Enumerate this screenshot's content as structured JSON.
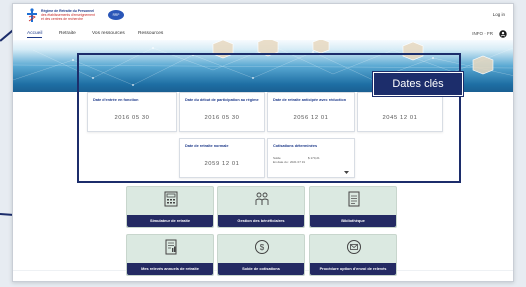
{
  "header": {
    "logo_line1": "Régime de Retraite du Personnel",
    "logo_line2": "des établissements d'enseignement",
    "logo_line3": "et des centres de recherche",
    "badge": "RRP",
    "login": "Log in"
  },
  "nav": {
    "items": [
      {
        "label": "Accueil",
        "active": true
      },
      {
        "label": "Retraite",
        "active": false
      },
      {
        "label": "Vos ressources",
        "active": false
      },
      {
        "label": "Ressources",
        "active": false
      }
    ],
    "right_text": "INFO · FR"
  },
  "callout": {
    "label": "Dates clés"
  },
  "cards": [
    {
      "title": "Date d'entrée en fonction",
      "value": "2016 05 30"
    },
    {
      "title": "Date du début de participation au régime",
      "value": "2016 05 30"
    },
    {
      "title": "Date de retraite anticipée avec réduction",
      "value": "2056 12 01"
    },
    {
      "title": "",
      "value": "2045 12 01"
    },
    {
      "title": "Date de retraite normale",
      "value": "2059 12 01"
    },
    {
      "title": "Cotisations déterminées",
      "row1_label": "Solde",
      "row1_value": "$ 170,21",
      "row2_label": "En date du : 2021 07 31"
    }
  ],
  "tiles": [
    {
      "label": "Simulateur de retraite",
      "icon": "calculator-icon"
    },
    {
      "label": "Gestion des bénéficiaires",
      "icon": "people-icon"
    },
    {
      "label": "Bibliothèque",
      "icon": "document-icon"
    },
    {
      "label": "Mes relevés annuels de retraite",
      "icon": "report-icon"
    },
    {
      "label": "Solde de cotisations",
      "icon": "dollar-icon"
    },
    {
      "label": "Procédure option d'envoi de relevés",
      "icon": "mail-icon"
    }
  ],
  "colors": {
    "navy": "#1c2d6b",
    "tile_bg": "#dbe9e1",
    "tile_label_bg": "#242a63",
    "accent_blue": "#1e3a8a"
  }
}
